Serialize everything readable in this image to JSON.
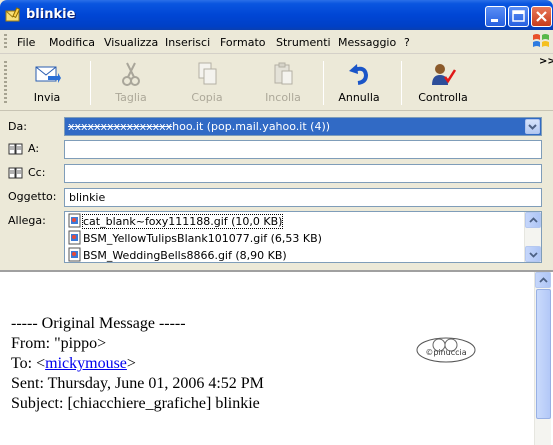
{
  "window": {
    "title": "blinkie"
  },
  "menu": [
    "File",
    "Modifica",
    "Visualizza",
    "Inserisci",
    "Formato",
    "Strumenti",
    "Messaggio",
    "?"
  ],
  "toolbar": {
    "send": "Invia",
    "cut": "Taglia",
    "copy": "Copia",
    "paste": "Incolla",
    "undo": "Annulla",
    "check": "Controlla",
    "overflow": ">>"
  },
  "header": {
    "from_label": "Da:",
    "from_account": "xxxxxxxxxxxxxxxx",
    "from_value": "hoo.it   (pop.mail.yahoo.it (4))",
    "to_label": "A:",
    "to_value": "",
    "cc_label": "Cc:",
    "cc_value": "",
    "subject_label": "Oggetto:",
    "subject_value": "blinkie",
    "attach_label": "Allega:",
    "attachments": [
      "cat_blank~foxy111188.gif (10,0 KB)",
      "BSM_YellowTulipsBlank101077.gif (6,53 KB)",
      "BSM_WeddingBells8866.gif (8,90 KB)"
    ]
  },
  "body": {
    "line1": "----- Original Message -----",
    "from": "From: \"pippo>",
    "to_prefix": "To: <",
    "to_link": "mickymouse",
    "to_suffix": ">",
    "sent": "Sent: Thursday, June 01, 2006 4:52 PM",
    "subject": "Subject: [chiacchiere_grafiche] blinkie",
    "stamp_text": "©pinuccia"
  },
  "colors": {
    "titlebar": "#0046d5",
    "selection": "#316ac5",
    "link": "#0000ee",
    "window_bg": "#ece9d8"
  }
}
